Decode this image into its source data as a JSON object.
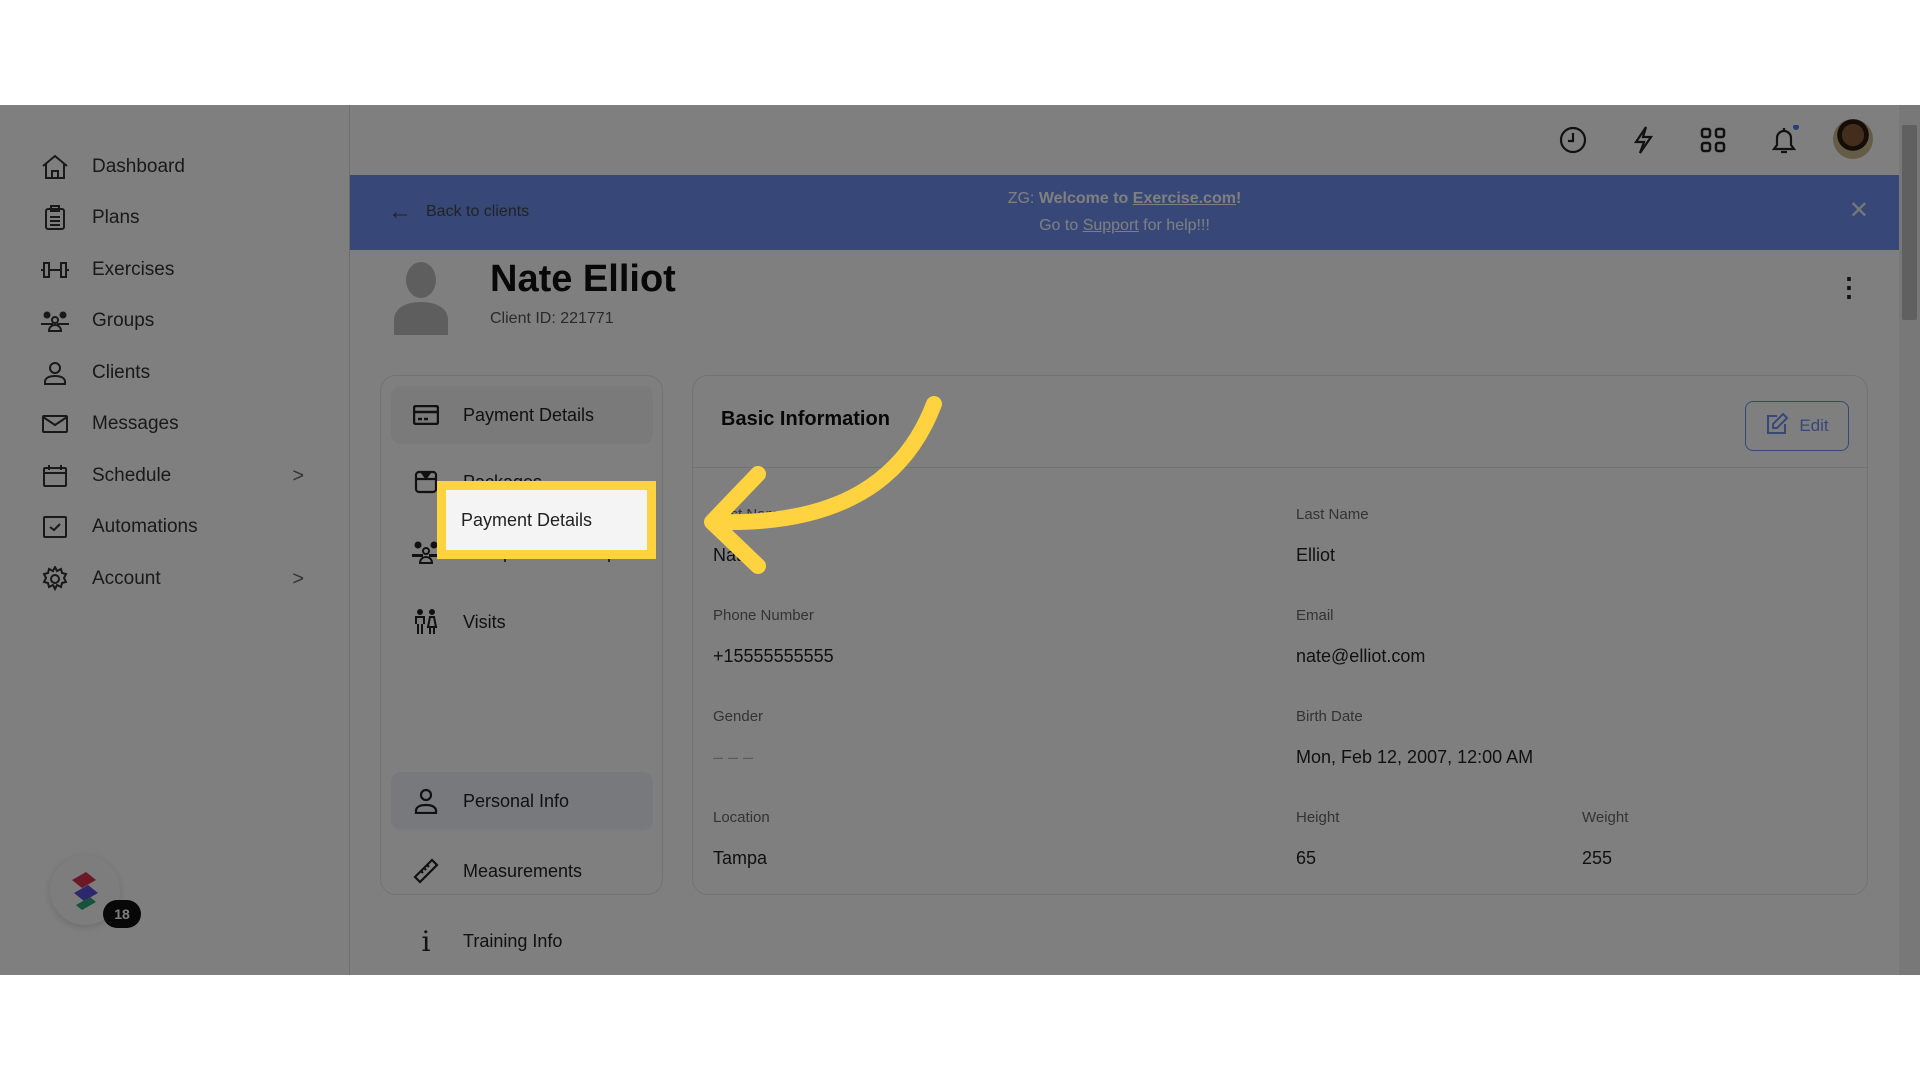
{
  "sidebar": {
    "items": [
      {
        "label": "Dashboard",
        "icon": "home-icon"
      },
      {
        "label": "Plans",
        "icon": "clipboard-icon"
      },
      {
        "label": "Exercises",
        "icon": "dumbbell-icon"
      },
      {
        "label": "Groups",
        "icon": "groups-icon"
      },
      {
        "label": "Clients",
        "icon": "user-icon"
      },
      {
        "label": "Messages",
        "icon": "mail-icon"
      },
      {
        "label": "Schedule",
        "icon": "calendar-icon",
        "has_submenu": true
      },
      {
        "label": "Automations",
        "icon": "checkbox-icon"
      },
      {
        "label": "Account",
        "icon": "gear-icon",
        "has_submenu": true
      }
    ],
    "widget_badge": "18"
  },
  "banner": {
    "prefix": "ZG: ",
    "welcome": "Welcome to ",
    "link1": "Exercise.com",
    "bang": "!",
    "line2_pre": "Go to ",
    "link2": "Support",
    "line2_post": " for help!!!",
    "color": "#6e91f1"
  },
  "back_label": "Back to clients",
  "client": {
    "name": "Nate Elliot",
    "id_label": "Client ID: 221771"
  },
  "tabs": [
    {
      "label": "Payment Details"
    },
    {
      "label": "Packages"
    },
    {
      "label": "Group Memberships"
    },
    {
      "label": "Visits"
    },
    {
      "label": "Personal Info",
      "active": true
    },
    {
      "label": "Measurements"
    },
    {
      "label": "Training Info"
    }
  ],
  "card": {
    "title": "Basic Information",
    "edit_label": "Edit",
    "fields": [
      {
        "label": "First Name",
        "value": "Nate"
      },
      {
        "label": "Last Name",
        "value": "Elliot"
      },
      {
        "label": "Phone Number",
        "value": "+15555555555"
      },
      {
        "label": "Email",
        "value": "nate@elliot.com"
      },
      {
        "label": "Gender",
        "value": "– – –"
      },
      {
        "label": "Birth Date",
        "value": "Mon, Feb 12, 2007, 12:00 AM"
      },
      {
        "label": "Location",
        "value": "Tampa"
      },
      {
        "label": "Height",
        "value": "65"
      },
      {
        "label": "Weight",
        "value": "255"
      }
    ]
  },
  "highlight": {
    "label": "Payment Details",
    "color": "#ffd23f"
  }
}
